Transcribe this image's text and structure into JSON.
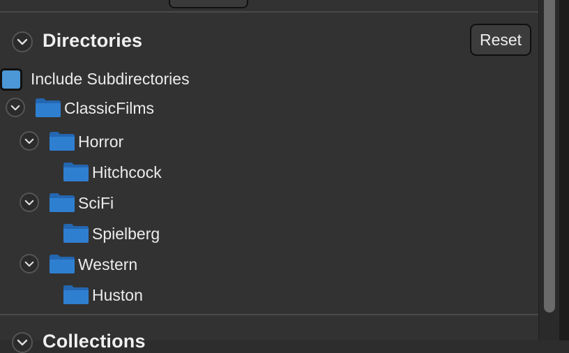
{
  "directories": {
    "title": "Directories",
    "reset_label": "Reset",
    "include_subdirectories_label": "Include Subdirectories",
    "include_subdirectories_checked": true
  },
  "tree": {
    "root": "ClassicFilms",
    "genres": [
      {
        "label": "Horror",
        "child": "Hitchcock"
      },
      {
        "label": "SciFi",
        "child": "Spielberg"
      },
      {
        "label": "Western",
        "child": "Huston"
      }
    ]
  },
  "next_section": {
    "title": "Collections"
  },
  "icons": {
    "disclosure": "chevron-down-icon",
    "folder": "folder-icon"
  },
  "colors": {
    "folder": "#2f7fd1",
    "checkbox": "#4c97d6",
    "background": "#323232"
  }
}
